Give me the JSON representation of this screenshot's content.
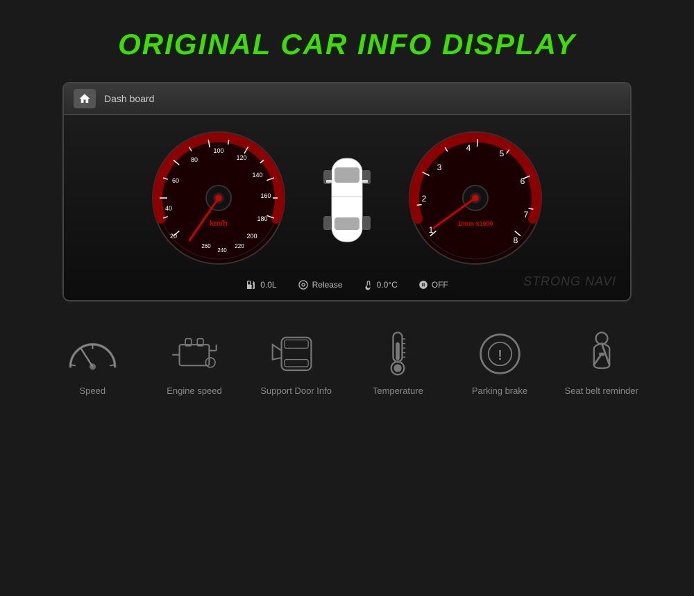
{
  "title": "ORIGINAL CAR INFO DISPLAY",
  "dashboard": {
    "header_label": "Dash board",
    "home_icon": "🏠",
    "speedometer_label": "km/h",
    "tachometer_label": "1/min x1000",
    "info_items": [
      {
        "icon": "⛽",
        "value": "0.0L"
      },
      {
        "icon": "🔘",
        "value": "Release"
      },
      {
        "icon": "🌡",
        "value": "0.0°C"
      },
      {
        "icon": "🔔",
        "value": "OFF"
      }
    ],
    "watermark": "STRONG NAVI"
  },
  "features": [
    {
      "label": "Speed",
      "icon_name": "speedometer-icon"
    },
    {
      "label": "Engine speed",
      "icon_name": "engine-icon"
    },
    {
      "label": "Support Door Info",
      "icon_name": "door-icon"
    },
    {
      "label": "Temperature",
      "icon_name": "temperature-icon"
    },
    {
      "label": "Parking brake",
      "icon_name": "parking-brake-icon"
    },
    {
      "label": "Seat belt reminder",
      "icon_name": "seatbelt-icon"
    }
  ]
}
